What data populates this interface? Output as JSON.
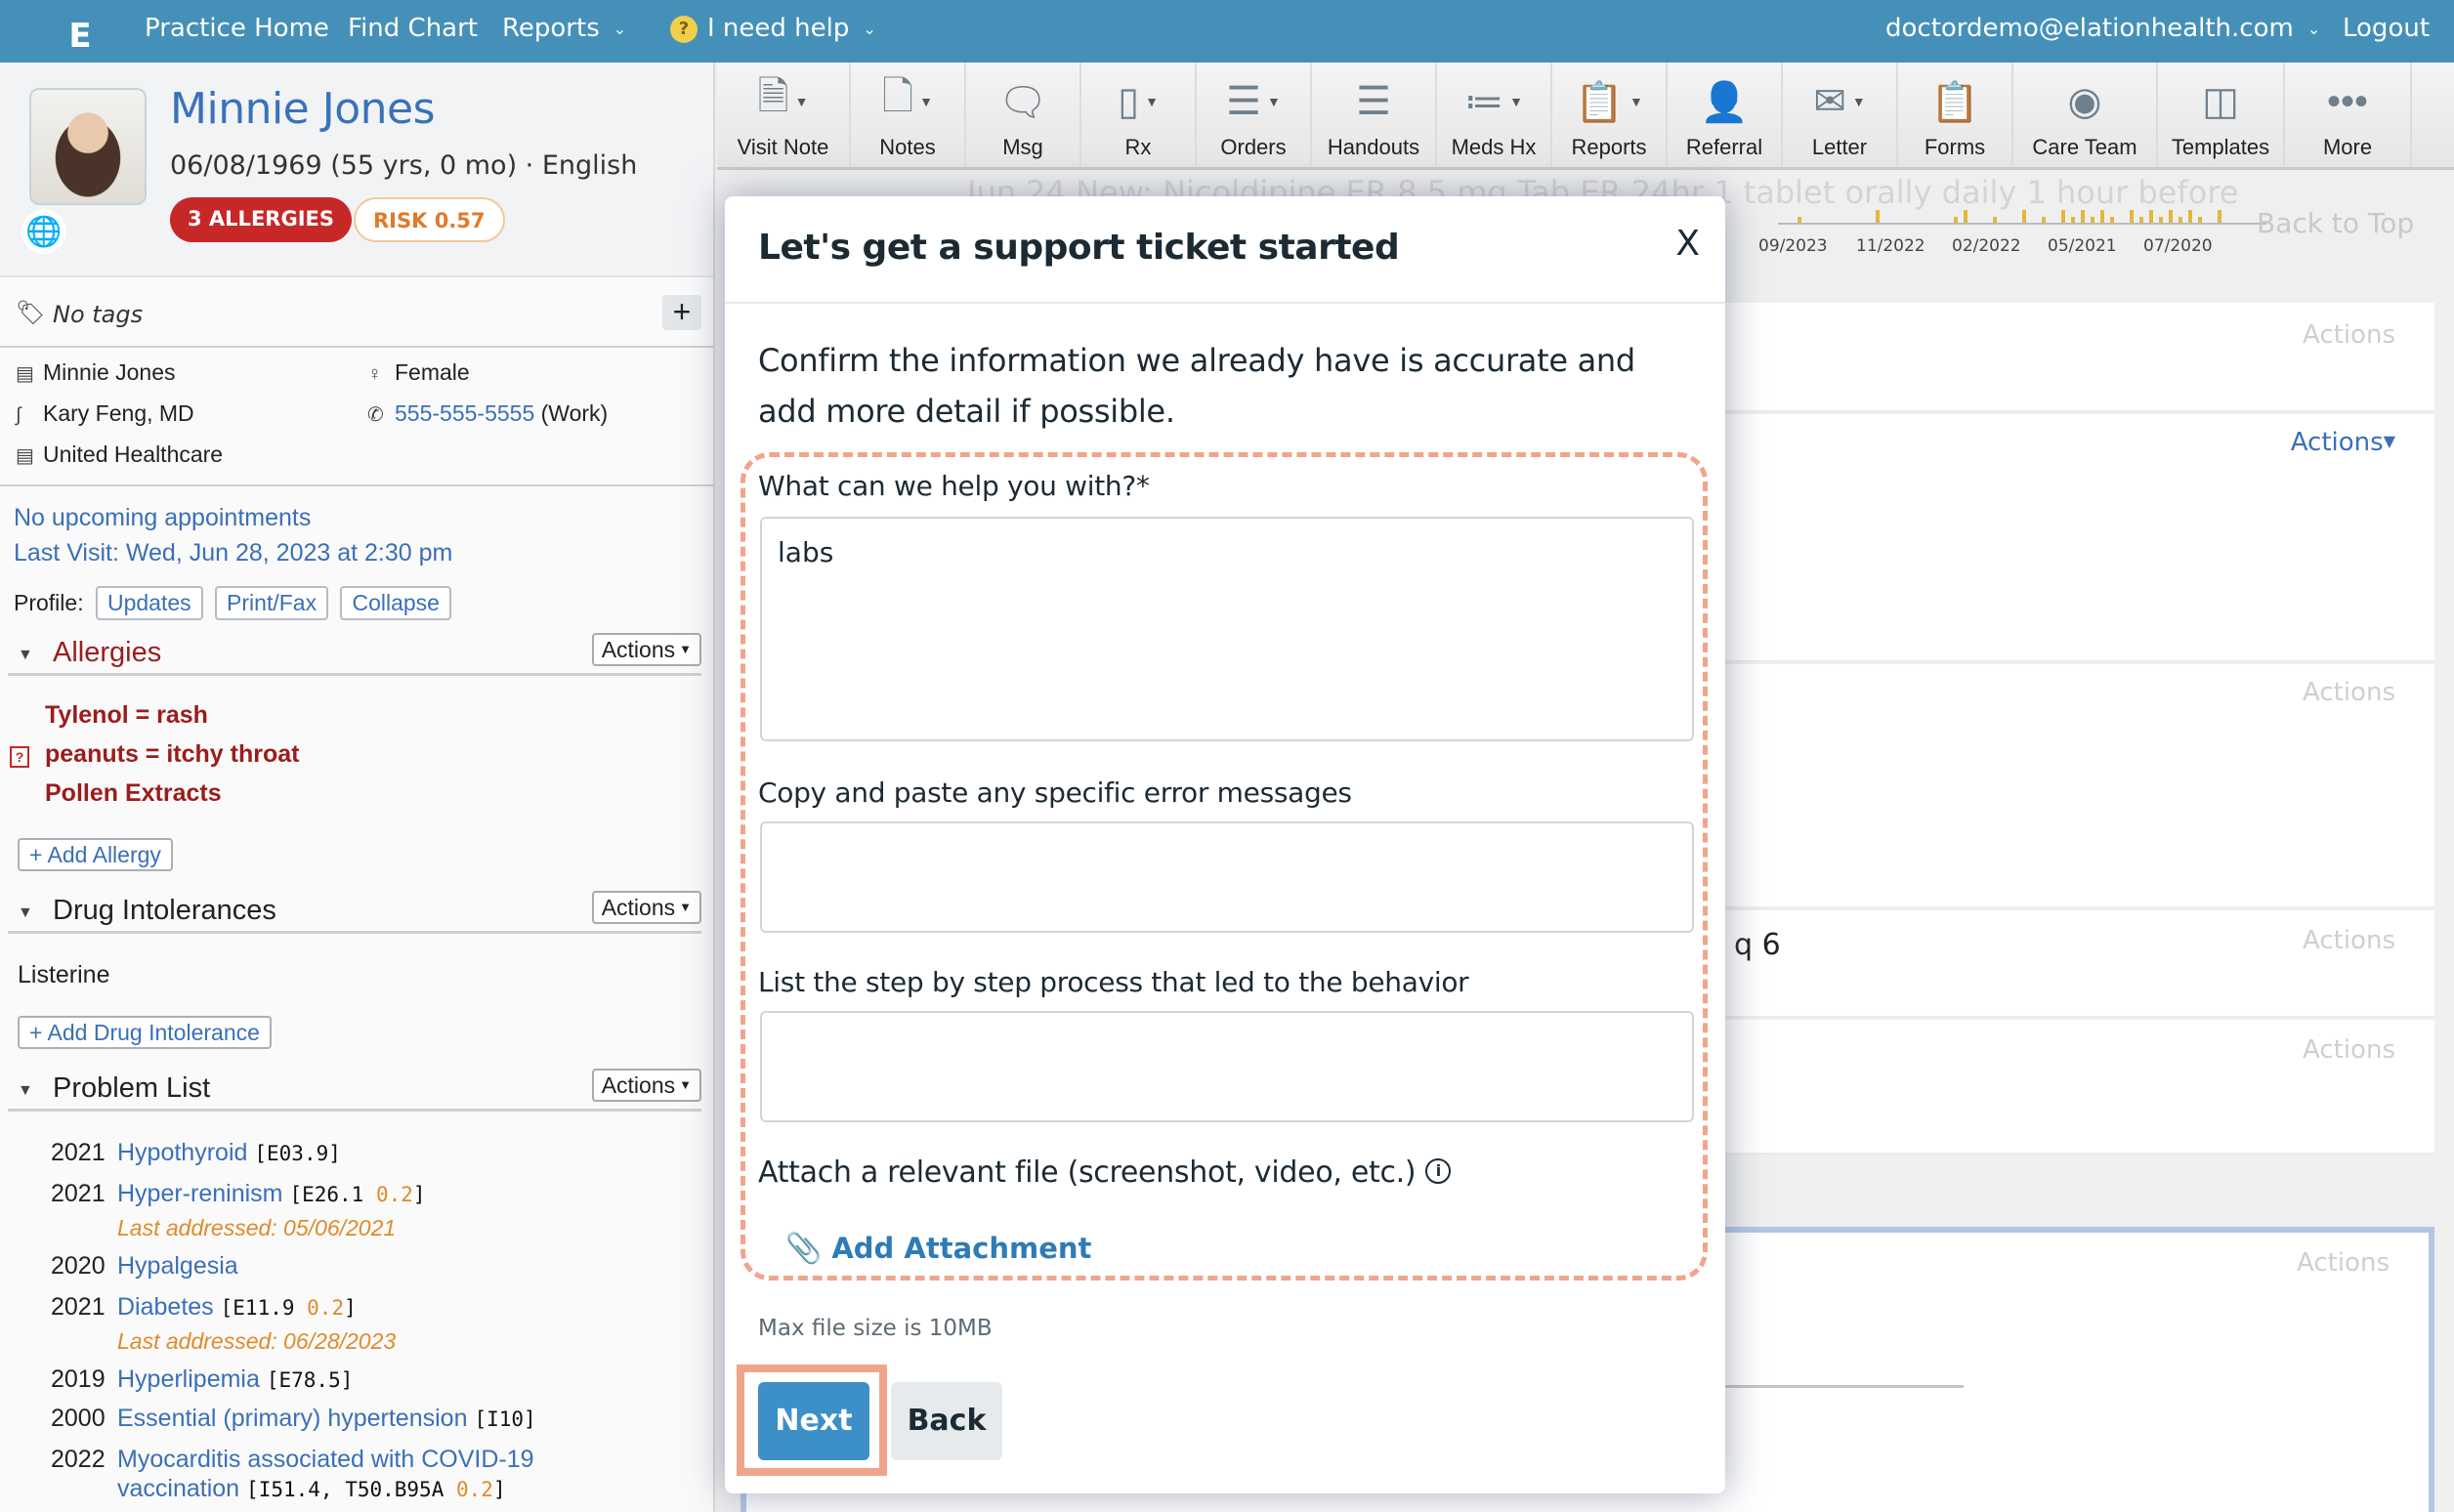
{
  "topnav": {
    "logo": "E",
    "items": [
      "Practice Home",
      "Find Chart",
      "Reports"
    ],
    "help_label": "I need help",
    "help_icon": "?",
    "user_email": "doctordemo@elationhealth.com",
    "logout": "Logout"
  },
  "patient": {
    "name": "Minnie Jones",
    "dob_line": "06/08/1969 (55 yrs, 0 mo) · English",
    "allergy_badge": "3 ALLERGIES",
    "risk_badge": "RISK 0.57",
    "tags": "No tags",
    "full_name": "Minnie Jones",
    "gender": "Female",
    "provider": "Kary Feng, MD",
    "phone": "555-555-5555",
    "phone_type": "(Work)",
    "insurance": "United Healthcare",
    "appointments": "No upcoming appointments",
    "last_visit": "Last Visit: Wed, Jun 28, 2023 at 2:30 pm",
    "profile_label": "Profile:",
    "profile_buttons": [
      "Updates",
      "Print/Fax",
      "Collapse"
    ]
  },
  "sections": {
    "actions_label": "Actions",
    "allergies": {
      "title": "Allergies",
      "items": [
        "Tylenol = rash",
        "peanuts = itchy throat",
        "Pollen Extracts"
      ],
      "add_label": "+ Add Allergy"
    },
    "drug_intolerances": {
      "title": "Drug Intolerances",
      "items": [
        "Listerine"
      ],
      "add_label": "+ Add Drug Intolerance"
    },
    "problem_list": {
      "title": "Problem List",
      "items": [
        {
          "year": "2021",
          "name": "Hypothyroid",
          "code": "E03.9",
          "sev": "",
          "sub": ""
        },
        {
          "year": "2021",
          "name": "Hyper-reninism",
          "code": "E26.1",
          "sev": "0.2",
          "sub": "Last addressed: 05/06/2021"
        },
        {
          "year": "2020",
          "name": "Hypalgesia",
          "code": "",
          "sev": "",
          "sub": ""
        },
        {
          "year": "2021",
          "name": "Diabetes",
          "code": "E11.9",
          "sev": "0.2",
          "sub": "Last addressed: 06/28/2023"
        },
        {
          "year": "2019",
          "name": "Hyperlipemia",
          "code": "E78.5",
          "sev": "",
          "sub": ""
        },
        {
          "year": "2000",
          "name": "Essential (primary) hypertension",
          "code": "I10",
          "sev": "",
          "sub": ""
        },
        {
          "year": "2022",
          "name": "Myocarditis associated with COVID-19",
          "name2": "vaccination",
          "code": "I51.4, T50.B95A",
          "sev": "0.2",
          "sub": ""
        }
      ]
    }
  },
  "toolbar": [
    {
      "label": "Visit Note",
      "icon": "visit-note-icon",
      "dropdown": true
    },
    {
      "label": "Notes",
      "icon": "notes-icon",
      "dropdown": true
    },
    {
      "label": "Msg",
      "icon": "message-icon",
      "dropdown": false
    },
    {
      "label": "Rx",
      "icon": "rx-pill-icon",
      "dropdown": true
    },
    {
      "label": "Orders",
      "icon": "orders-icon",
      "dropdown": true
    },
    {
      "label": "Handouts",
      "icon": "handouts-icon",
      "dropdown": false
    },
    {
      "label": "Meds Hx",
      "icon": "meds-history-icon",
      "dropdown": true
    },
    {
      "label": "Reports",
      "icon": "reports-icon",
      "dropdown": true
    },
    {
      "label": "Referral",
      "icon": "referral-icon",
      "dropdown": false
    },
    {
      "label": "Letter",
      "icon": "letter-icon",
      "dropdown": true
    },
    {
      "label": "Forms",
      "icon": "forms-icon",
      "dropdown": false
    },
    {
      "label": "Care Team",
      "icon": "care-team-icon",
      "dropdown": false
    },
    {
      "label": "Templates",
      "icon": "templates-icon",
      "dropdown": false
    },
    {
      "label": "More",
      "icon": "more-icon",
      "dropdown": false
    }
  ],
  "background": {
    "faded_text": "Jun 24    New: Nicoldipine ER 8.5 mg Tab ER 24hr 1 tablet orally daily 1 hour before",
    "timeline_ticks": [
      "09/2023",
      "11/2022",
      "02/2022",
      "05/2021",
      "07/2020"
    ],
    "back_to_top": "Back to Top",
    "actions_label": "Actions",
    "q6_fragment": "q 6"
  },
  "modal": {
    "title": "Let's get a support ticket started",
    "close": "X",
    "intro": "Confirm the information we already have is accurate and add more detail if possible.",
    "fields": [
      {
        "label": "What can we help you with?*",
        "value": "labs"
      },
      {
        "label": "Copy and paste any specific error messages",
        "value": ""
      },
      {
        "label": "List the step by step process that led to the behavior",
        "value": ""
      }
    ],
    "attach_label": "Attach a relevant file (screenshot, video, etc.)",
    "add_attachment": "Add Attachment",
    "max_size": "Max file size is 10MB",
    "next": "Next",
    "back": "Back"
  },
  "colors": {
    "nav_blue": "#4590b8",
    "link_blue": "#3a6fb8",
    "allergy_red": "#9b1c1c",
    "badge_red": "#c62828",
    "risk_orange": "#e07a2a",
    "highlight_salmon": "#efa58c",
    "next_blue": "#3d8fc8"
  }
}
